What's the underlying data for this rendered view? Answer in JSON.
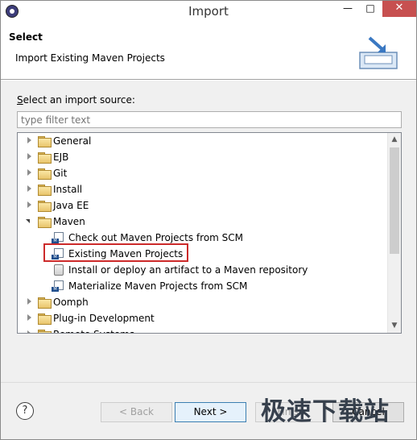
{
  "window": {
    "title": "Import",
    "minimize_label": "—",
    "maximize_label": "□",
    "close_label": "✕"
  },
  "banner": {
    "title": "Select",
    "description": "Import Existing Maven Projects"
  },
  "source": {
    "label_first": "S",
    "label_rest": "elect an import source:",
    "filter_placeholder": "type filter text"
  },
  "tree": {
    "items": [
      {
        "label": "General",
        "type": "folder",
        "state": "collapsed"
      },
      {
        "label": "EJB",
        "type": "folder",
        "state": "collapsed"
      },
      {
        "label": "Git",
        "type": "folder",
        "state": "collapsed"
      },
      {
        "label": "Install",
        "type": "folder",
        "state": "collapsed"
      },
      {
        "label": "Java EE",
        "type": "folder",
        "state": "collapsed"
      },
      {
        "label": "Maven",
        "type": "folder",
        "state": "expanded"
      },
      {
        "label": "Check out Maven Projects from SCM",
        "type": "maven-item"
      },
      {
        "label": "Existing Maven Projects",
        "type": "maven-item",
        "selected": true
      },
      {
        "label": "Install or deploy an artifact to a Maven repository",
        "type": "jar-item"
      },
      {
        "label": "Materialize Maven Projects from SCM",
        "type": "maven-item"
      },
      {
        "label": "Oomph",
        "type": "folder",
        "state": "collapsed"
      },
      {
        "label": "Plug-in Development",
        "type": "folder",
        "state": "collapsed"
      },
      {
        "label": "Remote Systems",
        "type": "folder",
        "state": "collapsed"
      }
    ],
    "highlight_color": "#cc2a2a"
  },
  "buttons": {
    "help": "?",
    "back": "< Back",
    "next": "Next >",
    "finish": "Finish",
    "cancel": "Cancel"
  },
  "watermark": "极速下载站"
}
